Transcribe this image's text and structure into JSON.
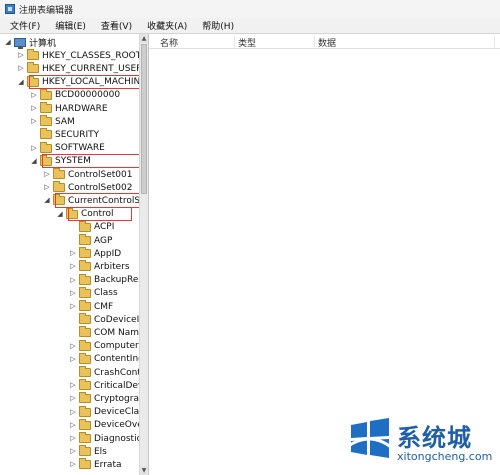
{
  "window": {
    "title": "注册表编辑器"
  },
  "menu": [
    "文件(F)",
    "编辑(E)",
    "查看(V)",
    "收藏夹(A)",
    "帮助(H)"
  ],
  "columns": [
    "名称",
    "类型",
    "数据"
  ],
  "tree": [
    {
      "label": "计算机",
      "level": 0,
      "expander": "◢",
      "icon": "computer-icon"
    },
    {
      "label": "HKEY_CLASSES_ROOT",
      "level": 1,
      "expander": "▷",
      "icon": "folder-icon"
    },
    {
      "label": "HKEY_CURRENT_USER",
      "level": 1,
      "expander": "▷",
      "icon": "folder-icon"
    },
    {
      "label": "HKEY_LOCAL_MACHINE",
      "level": 1,
      "expander": "◢",
      "icon": "folder-icon",
      "highlight": true
    },
    {
      "label": "BCD00000000",
      "level": 2,
      "expander": "▷",
      "icon": "folder-icon"
    },
    {
      "label": "HARDWARE",
      "level": 2,
      "expander": "▷",
      "icon": "folder-icon"
    },
    {
      "label": "SAM",
      "level": 2,
      "expander": "▷",
      "icon": "folder-icon"
    },
    {
      "label": "SECURITY",
      "level": 2,
      "expander": "",
      "icon": "folder-icon"
    },
    {
      "label": "SOFTWARE",
      "level": 2,
      "expander": "▷",
      "icon": "folder-icon"
    },
    {
      "label": "SYSTEM",
      "level": 2,
      "expander": "◢",
      "icon": "folder-icon",
      "highlight": true
    },
    {
      "label": "ControlSet001",
      "level": 3,
      "expander": "▷",
      "icon": "folder-icon"
    },
    {
      "label": "ControlSet002",
      "level": 3,
      "expander": "▷",
      "icon": "folder-icon"
    },
    {
      "label": "CurrentControlSet",
      "level": 3,
      "expander": "◢",
      "icon": "folder-icon",
      "highlight": true
    },
    {
      "label": "Control",
      "level": 4,
      "expander": "◢",
      "icon": "folder-icon",
      "highlight": true
    },
    {
      "label": "ACPI",
      "level": 5,
      "expander": "",
      "icon": "folder-icon"
    },
    {
      "label": "AGP",
      "level": 5,
      "expander": "",
      "icon": "folder-icon"
    },
    {
      "label": "AppID",
      "level": 5,
      "expander": "▷",
      "icon": "folder-icon"
    },
    {
      "label": "Arbiters",
      "level": 5,
      "expander": "▷",
      "icon": "folder-icon"
    },
    {
      "label": "BackupRestore",
      "level": 5,
      "expander": "▷",
      "icon": "folder-icon"
    },
    {
      "label": "Class",
      "level": 5,
      "expander": "▷",
      "icon": "folder-icon"
    },
    {
      "label": "CMF",
      "level": 5,
      "expander": "▷",
      "icon": "folder-icon"
    },
    {
      "label": "CoDeviceInstallers",
      "level": 5,
      "expander": "",
      "icon": "folder-icon"
    },
    {
      "label": "COM Name Arbiter",
      "level": 5,
      "expander": "",
      "icon": "folder-icon"
    },
    {
      "label": "ComputerName",
      "level": 5,
      "expander": "▷",
      "icon": "folder-icon"
    },
    {
      "label": "ContentIndex",
      "level": 5,
      "expander": "▷",
      "icon": "folder-icon"
    },
    {
      "label": "CrashControl",
      "level": 5,
      "expander": "",
      "icon": "folder-icon"
    },
    {
      "label": "CriticalDeviceDatabase",
      "level": 5,
      "expander": "▷",
      "icon": "folder-icon"
    },
    {
      "label": "Cryptography",
      "level": 5,
      "expander": "▷",
      "icon": "folder-icon"
    },
    {
      "label": "DeviceClasses",
      "level": 5,
      "expander": "▷",
      "icon": "folder-icon"
    },
    {
      "label": "DeviceOverrides",
      "level": 5,
      "expander": "▷",
      "icon": "folder-icon"
    },
    {
      "label": "Diagnostics",
      "level": 5,
      "expander": "▷",
      "icon": "folder-icon"
    },
    {
      "label": "Els",
      "level": 5,
      "expander": "▷",
      "icon": "folder-icon"
    },
    {
      "label": "Errata",
      "level": 5,
      "expander": "▷",
      "icon": "folder-icon"
    }
  ],
  "watermark": {
    "brand": "系统城",
    "domain": "xitongcheng.com"
  },
  "colors": {
    "highlight": "#e53935",
    "brand": "#1e5fa8",
    "folder": "#e9c25a"
  }
}
